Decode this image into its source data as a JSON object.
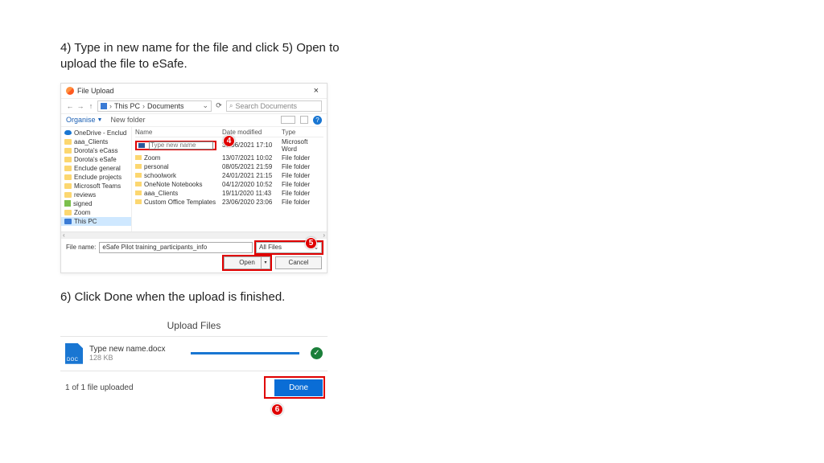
{
  "instructions": {
    "step4_5": "4) Type in new name for the file and click 5) Open to upload the file to eSafe.",
    "step6": "6) Click Done when the upload is finished."
  },
  "dialog": {
    "title": "File Upload",
    "path_root": "This PC",
    "path_cur": "Documents",
    "search_placeholder": "Search Documents",
    "organise": "Organise",
    "new_folder": "New folder",
    "headers": {
      "name": "Name",
      "date": "Date modified",
      "type": "Type"
    },
    "tree": [
      "OneDrive - Enclud",
      "aaa_Clients",
      "Dorota's eCass",
      "Dorota's eSafe",
      "Enclude general",
      "Enclude projects",
      "Microsoft Teams",
      "reviews",
      "signed",
      "Zoom",
      "This PC"
    ],
    "rename_placeholder": "Type new name",
    "files": [
      {
        "name": "",
        "date": "30/06/2021 17:10",
        "type": "Microsoft Word",
        "word": true,
        "edit": true
      },
      {
        "name": "Zoom",
        "date": "13/07/2021 10:02",
        "type": "File folder"
      },
      {
        "name": "personal",
        "date": "08/05/2021 21:59",
        "type": "File folder"
      },
      {
        "name": "schoolwork",
        "date": "24/01/2021 21:15",
        "type": "File folder"
      },
      {
        "name": "OneNote Notebooks",
        "date": "04/12/2020 10:52",
        "type": "File folder"
      },
      {
        "name": "aaa_Clients",
        "date": "19/11/2020 11:43",
        "type": "File folder"
      },
      {
        "name": "Custom Office Templates",
        "date": "23/06/2020 23:06",
        "type": "File folder"
      }
    ],
    "file_name_label": "File name:",
    "file_name_value": "eSafe Pilot training_participants_info",
    "filter": "All Files",
    "open": "Open",
    "cancel": "Cancel"
  },
  "badges": {
    "b4": "4",
    "b5": "5",
    "b6": "6"
  },
  "upload": {
    "title": "Upload Files",
    "file": "Type new name.docx",
    "size": "128 KB",
    "ext": "DOC",
    "count": "1 of 1 file uploaded",
    "done": "Done"
  }
}
